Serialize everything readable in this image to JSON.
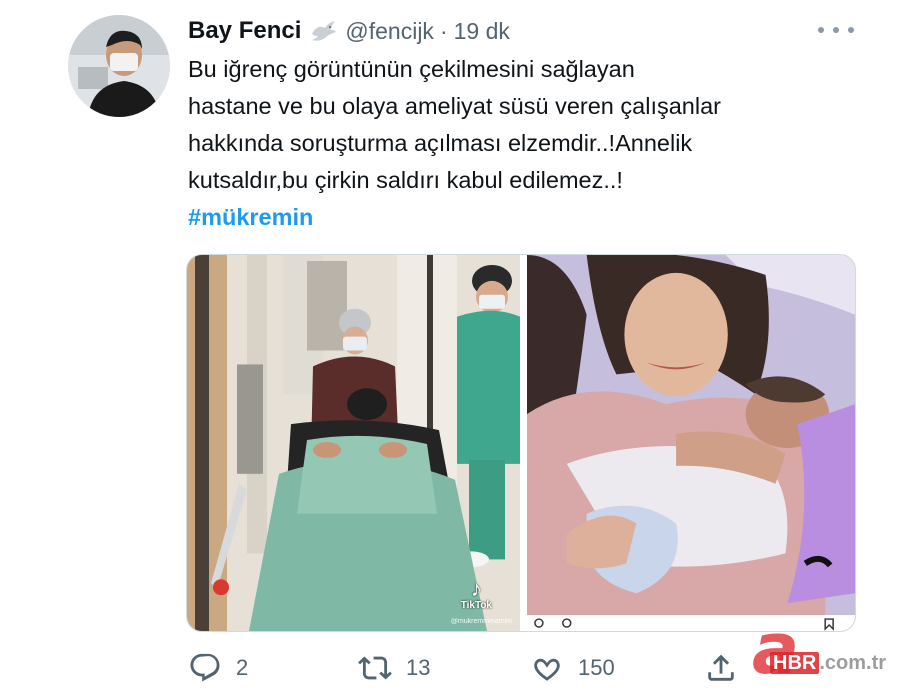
{
  "tweet": {
    "display_name": "Bay Fenci",
    "handle": "@fencijk",
    "separator": "·",
    "time": "19 dk",
    "text_lines": [
      "Bu iğrenç görüntünün çekilmesini sağlayan",
      "hastane ve bu olaya ameliyat süsü veren çalışanlar",
      "hakkında soruşturma açılması elzemdir..!Annelik",
      "kutsaldır,bu çirkin saldırı kabul edilemez..!"
    ],
    "hashtag": "#mükremin"
  },
  "media": {
    "left_overlay": {
      "brand": "TikTok",
      "user": "@mukremmmamim"
    }
  },
  "actions": {
    "replies": "2",
    "retweets": "13",
    "likes": "150"
  },
  "watermark": {
    "letter": "a",
    "brand": "HBR",
    "domain": ".com.tr"
  },
  "icons": {
    "verified_badge": "dove-icon",
    "more": "more-icon",
    "reply": "reply-icon",
    "retweet": "retweet-icon",
    "like": "heart-icon",
    "share": "share-icon"
  },
  "colors": {
    "text": "#0f1419",
    "secondary": "#536471",
    "hashtag": "#1d9bf0",
    "border": "#cfd9de"
  }
}
